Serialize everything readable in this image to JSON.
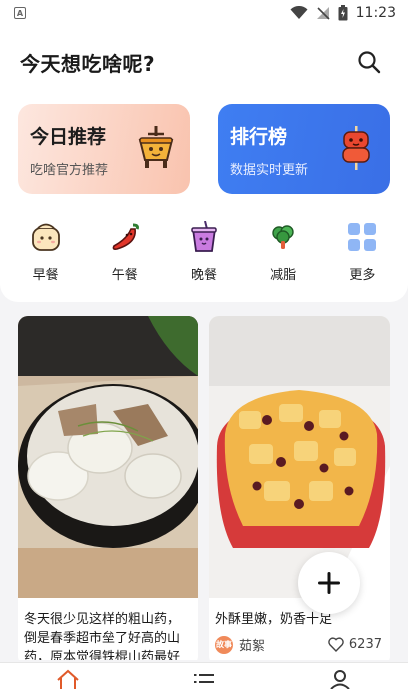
{
  "status_bar": {
    "time": "11:23"
  },
  "header": {
    "title": "今天想吃啥呢?"
  },
  "cards": [
    {
      "title": "今日推荐",
      "subtitle": "吃啥官方推荐"
    },
    {
      "title": "排行榜",
      "subtitle": "数据实时更新"
    }
  ],
  "categories": [
    {
      "label": "早餐",
      "icon": "bun-icon"
    },
    {
      "label": "午餐",
      "icon": "chili-icon"
    },
    {
      "label": "晚餐",
      "icon": "drink-cup-icon"
    },
    {
      "label": "减脂",
      "icon": "broccoli-icon"
    },
    {
      "label": "更多",
      "icon": "grid-icon"
    }
  ],
  "feed": [
    {
      "caption": "冬天很少见这样的粗山药，倒是春季超市垒了好高的山药，原本觉得铁棍山药最好吃，昨过这个山药之后大"
    },
    {
      "caption": "外酥里嫩，奶香十足",
      "author": "茹絮",
      "avatar_text": "故事",
      "likes": "6237"
    }
  ],
  "colors": {
    "rank_card": "#3f7ef2",
    "today_card": "#f9c3ae",
    "accent": "#e05a2a"
  }
}
